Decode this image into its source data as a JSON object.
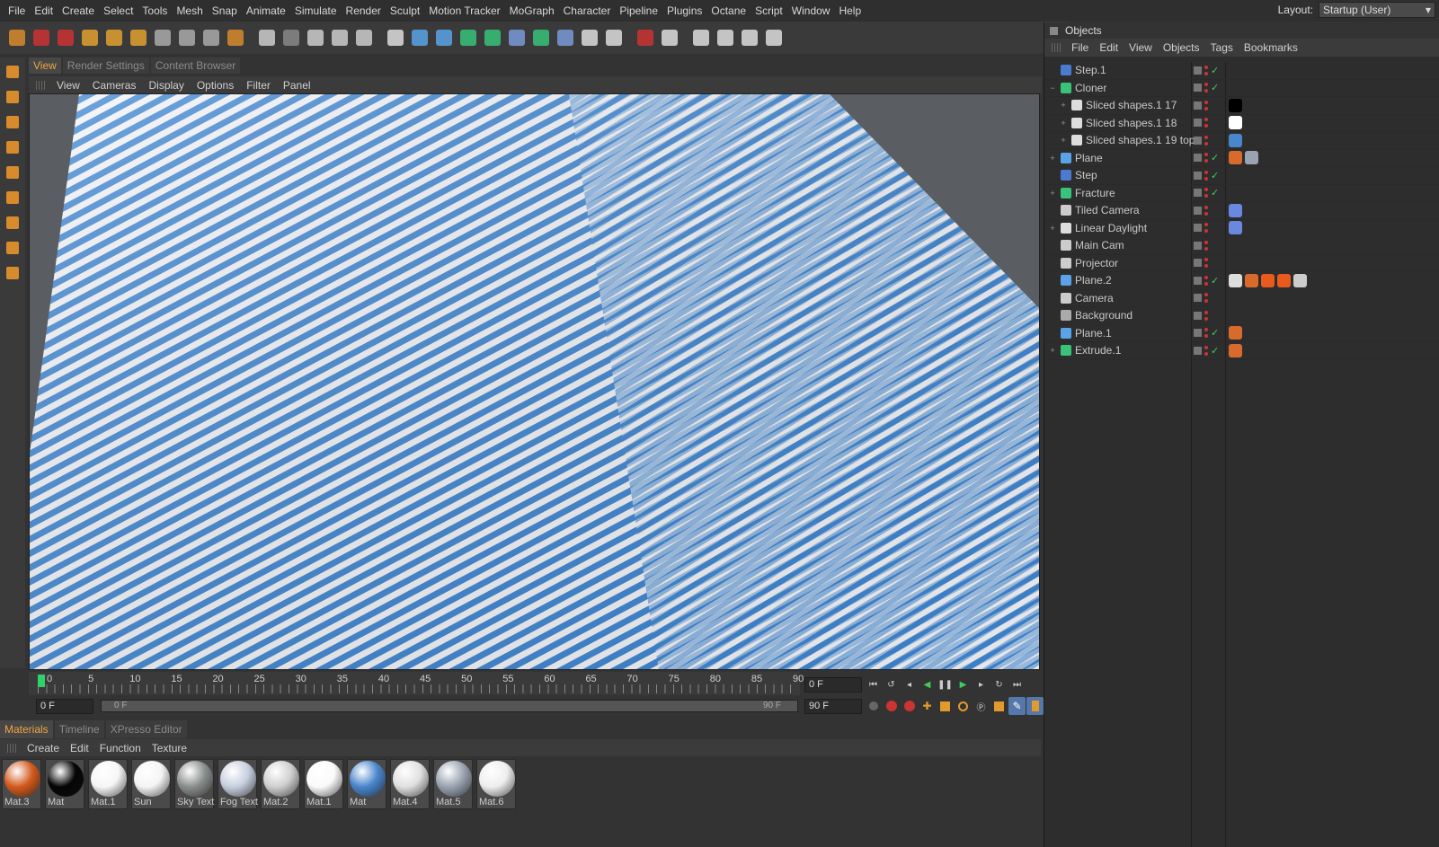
{
  "menubar": [
    "File",
    "Edit",
    "Create",
    "Select",
    "Tools",
    "Mesh",
    "Snap",
    "Animate",
    "Simulate",
    "Render",
    "Sculpt",
    "Motion Tracker",
    "MoGraph",
    "Character",
    "Pipeline",
    "Plugins",
    "Octane",
    "Script",
    "Window",
    "Help"
  ],
  "layout": {
    "label": "Layout:",
    "value": "Startup (User)"
  },
  "view_tabs": [
    "View",
    "Render Settings",
    "Content Browser"
  ],
  "view_menu": [
    "View",
    "Cameras",
    "Display",
    "Options",
    "Filter",
    "Panel"
  ],
  "timeline": {
    "ticks": [
      "0",
      "5",
      "10",
      "15",
      "20",
      "25",
      "30",
      "35",
      "40",
      "45",
      "50",
      "55",
      "60",
      "65",
      "70",
      "75",
      "80",
      "85",
      "90"
    ],
    "current_frame": "0 F",
    "start_frame": "0 F",
    "min_frame": "0 F",
    "max_frame": "90 F",
    "end_frame": "90 F",
    "end_frame_right": "90 F"
  },
  "material_tabs": [
    "Materials",
    "Timeline",
    "XPresso Editor"
  ],
  "material_menu": [
    "Create",
    "Edit",
    "Function",
    "Texture"
  ],
  "materials": [
    {
      "name": "Mat.3",
      "color": "#d45a1e"
    },
    {
      "name": "Mat",
      "color": "#050505"
    },
    {
      "name": "Mat.1",
      "color": "#f6f6f6"
    },
    {
      "name": "Sun",
      "color": "#f4f4f4"
    },
    {
      "name": "Sky Text",
      "color": "#8a8f8c"
    },
    {
      "name": "Fog Text",
      "color": "#c7cfe0"
    },
    {
      "name": "Mat.2",
      "color": "#cfcfcf"
    },
    {
      "name": "Mat.1",
      "color": "#fafafa"
    },
    {
      "name": "Mat",
      "color": "#4a86cc"
    },
    {
      "name": "Mat.4",
      "color": "#e0e0e0"
    },
    {
      "name": "Mat.5",
      "color": "#9aa3b0"
    },
    {
      "name": "Mat.6",
      "color": "#eeeeee"
    }
  ],
  "objects_panel": {
    "title": "Objects",
    "menu": [
      "File",
      "Edit",
      "View",
      "Objects",
      "Tags",
      "Bookmarks"
    ],
    "objects": [
      {
        "name": "Step.1",
        "indent": 0,
        "expand": "",
        "icon": "#4a7bd0",
        "check": "✓"
      },
      {
        "name": "Cloner",
        "indent": 0,
        "expand": "−",
        "icon": "#38c27a",
        "check": "✓"
      },
      {
        "name": "Sliced shapes.1 17",
        "indent": 1,
        "expand": "+",
        "icon": "#dddddd",
        "check": ""
      },
      {
        "name": "Sliced shapes.1 18",
        "indent": 1,
        "expand": "+",
        "icon": "#dddddd",
        "check": ""
      },
      {
        "name": "Sliced shapes.1 19 top",
        "indent": 1,
        "expand": "+",
        "icon": "#dddddd",
        "check": ""
      },
      {
        "name": "Plane",
        "indent": 0,
        "expand": "+",
        "icon": "#5aa3e8",
        "check": "✓"
      },
      {
        "name": "Step",
        "indent": 0,
        "expand": "",
        "icon": "#4a7bd0",
        "check": "✓"
      },
      {
        "name": "Fracture",
        "indent": 0,
        "expand": "+",
        "icon": "#38c27a",
        "check": "✓"
      },
      {
        "name": "Tiled Camera",
        "indent": 0,
        "expand": "",
        "icon": "#cccccc",
        "check": ""
      },
      {
        "name": "Linear Daylight",
        "indent": 0,
        "expand": "+",
        "icon": "#dddddd",
        "check": ""
      },
      {
        "name": "Main Cam",
        "indent": 0,
        "expand": "",
        "icon": "#cccccc",
        "check": ""
      },
      {
        "name": "Projector",
        "indent": 0,
        "expand": "",
        "icon": "#cccccc",
        "check": ""
      },
      {
        "name": "Plane.2",
        "indent": 0,
        "expand": "",
        "icon": "#5aa3e8",
        "check": "✓"
      },
      {
        "name": "Camera",
        "indent": 0,
        "expand": "",
        "icon": "#cccccc",
        "check": ""
      },
      {
        "name": "Background",
        "indent": 0,
        "expand": "",
        "icon": "#aaaaaa",
        "check": ""
      },
      {
        "name": "Plane.1",
        "indent": 0,
        "expand": "",
        "icon": "#5aa3e8",
        "check": "✓"
      },
      {
        "name": "Extrude.1",
        "indent": 0,
        "expand": "+",
        "icon": "#38c27a",
        "check": "✓"
      }
    ]
  },
  "colors": {
    "accent": "#f0a540",
    "stripe_blue": "#3f86d2",
    "stripe_white": "#f2f4f8",
    "check_green": "#3ecf5a"
  }
}
